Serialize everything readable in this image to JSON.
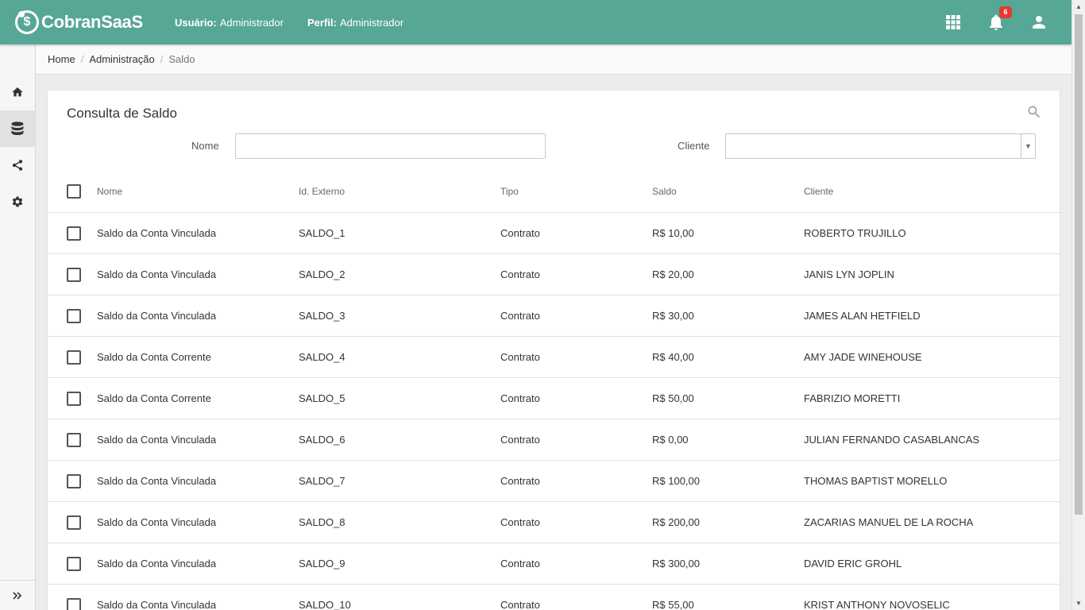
{
  "app": {
    "brand": "CobranSaaS",
    "brand_mark": "$"
  },
  "header": {
    "user_label": "Usuário:",
    "user_value": "Administrador",
    "profile_label": "Perfil:",
    "profile_value": "Administrador",
    "notifications_count": "6"
  },
  "sidebar": {
    "items": [
      {
        "icon": "home-icon",
        "active": false
      },
      {
        "icon": "database-icon",
        "active": true
      },
      {
        "icon": "share-icon",
        "active": false
      },
      {
        "icon": "gear-icon",
        "active": false
      }
    ],
    "expand_icon": "double-chevron-right-icon"
  },
  "breadcrumb": [
    "Home",
    "Administração",
    "Saldo"
  ],
  "page": {
    "title": "Consulta de Saldo",
    "filters": {
      "nome_label": "Nome",
      "nome_value": "",
      "cliente_label": "Cliente",
      "cliente_value": ""
    }
  },
  "table": {
    "headers": [
      "Nome",
      "Id. Externo",
      "Tipo",
      "Saldo",
      "Cliente"
    ],
    "rows": [
      [
        "Saldo da Conta Vinculada",
        "SALDO_1",
        "Contrato",
        "R$ 10,00",
        "ROBERTO TRUJILLO"
      ],
      [
        "Saldo da Conta Vinculada",
        "SALDO_2",
        "Contrato",
        "R$ 20,00",
        "JANIS LYN JOPLIN"
      ],
      [
        "Saldo da Conta Vinculada",
        "SALDO_3",
        "Contrato",
        "R$ 30,00",
        "JAMES ALAN HETFIELD"
      ],
      [
        "Saldo da Conta Corrente",
        "SALDO_4",
        "Contrato",
        "R$ 40,00",
        "AMY JADE WINEHOUSE"
      ],
      [
        "Saldo da Conta Corrente",
        "SALDO_5",
        "Contrato",
        "R$ 50,00",
        "FABRIZIO MORETTI"
      ],
      [
        "Saldo da Conta Vinculada",
        "SALDO_6",
        "Contrato",
        "R$ 0,00",
        "JULIAN FERNANDO CASABLANCAS"
      ],
      [
        "Saldo da Conta Vinculada",
        "SALDO_7",
        "Contrato",
        "R$ 100,00",
        "THOMAS BAPTIST MORELLO"
      ],
      [
        "Saldo da Conta Vinculada",
        "SALDO_8",
        "Contrato",
        "R$ 200,00",
        "ZACARIAS MANUEL DE LA ROCHA"
      ],
      [
        "Saldo da Conta Vinculada",
        "SALDO_9",
        "Contrato",
        "R$ 300,00",
        "DAVID ERIC GROHL"
      ],
      [
        "Saldo da Conta Vinculada",
        "SALDO_10",
        "Contrato",
        "R$ 55,00",
        "KRIST ANTHONY NOVOSELIC"
      ]
    ]
  },
  "colors": {
    "primary": "#57a797",
    "badge": "#e53935"
  }
}
